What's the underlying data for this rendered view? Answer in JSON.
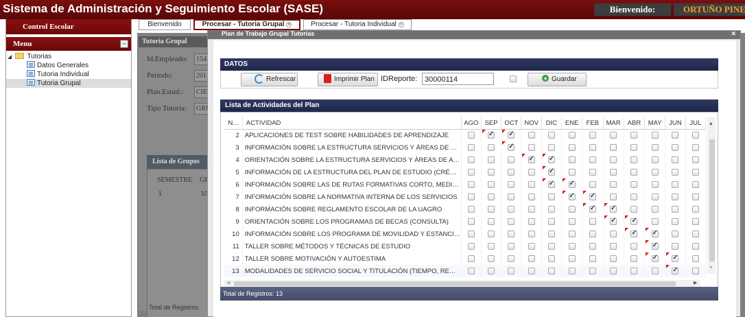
{
  "app": {
    "title": "Sistema de Administración y Seguimiento Escolar (SASE)",
    "welcome": "Bienvenido:",
    "user": "ORTUÑO PINE"
  },
  "sidebar": {
    "header": "Control Escolar",
    "menu_title": "Menu",
    "collapse_glyph": "–",
    "tree": {
      "root_label": "Tutorias",
      "items": [
        "Datos Generales",
        "Tutoria Individual",
        "Tutoria Grupal"
      ],
      "selected_index": 2
    }
  },
  "tabs": [
    {
      "label": "Bienvenido",
      "closable": false,
      "active": false
    },
    {
      "label": "Procesar - Tutoria Grupal",
      "closable": true,
      "active": true
    },
    {
      "label": "Procesar - Tutoria Individual",
      "closable": true,
      "active": false
    }
  ],
  "background_panel": {
    "title": "Tutoria Grupal",
    "fields": [
      {
        "label": "Id.Empleado:",
        "value": "154"
      },
      {
        "label": "Periodo:",
        "value": "201"
      },
      {
        "label": "Plan.Estud.:",
        "value": "CIE"
      },
      {
        "label": "Tipo Tutoria:",
        "value": "GRU"
      }
    ],
    "groups_title": "Lista de Grupos",
    "groups_columns": [
      "SEMESTRE",
      "GR"
    ],
    "groups_row": [
      "1",
      "10"
    ],
    "groups_total": "Total de Registros"
  },
  "modal": {
    "title": "Plan de Trabajo Grupal Tutorias",
    "datos_title": "DATOS",
    "refresh_label": "Refrescar",
    "print_label": "Imprimir Plan",
    "idreporte_label": "IDReporte:",
    "idreporte_value": "30000114",
    "save_label": "Guardar",
    "save_checkbox_checked": false,
    "list_title": "Lista de Actividades del Plan",
    "columns": [
      "N...",
      "ACTIVIDAD",
      "AGO",
      "SEP",
      "OCT",
      "NOV",
      "DIC",
      "ENE",
      "FEB",
      "MAR",
      "ABR",
      "MAY",
      "JUN",
      "JUL"
    ],
    "rows": [
      {
        "n": "2",
        "actividad": "APLICACIONES DE TEST SOBRE HABILIDADES DE APRENDIZAJE",
        "months": [
          0,
          1,
          1,
          0,
          0,
          0,
          0,
          0,
          0,
          0,
          0,
          0
        ],
        "dirty": [
          0,
          1,
          1,
          0,
          0,
          0,
          0,
          0,
          0,
          0,
          0,
          0
        ]
      },
      {
        "n": "3",
        "actividad": "INFORMACIÓN SOBRE LA ESTRUCTURA SERVICIOS Y ÁREAS DE APOYO",
        "months": [
          0,
          0,
          1,
          0,
          0,
          0,
          0,
          0,
          0,
          0,
          0,
          0
        ],
        "dirty": [
          0,
          0,
          1,
          0,
          0,
          0,
          0,
          0,
          0,
          0,
          0,
          0
        ]
      },
      {
        "n": "4",
        "actividad": "ORIENTACIÓN SOBRE LA ESTRUCTURA SERVICIOS Y ÁREAS DE APOYO",
        "months": [
          0,
          0,
          0,
          1,
          1,
          0,
          0,
          0,
          0,
          0,
          0,
          0
        ],
        "dirty": [
          0,
          0,
          0,
          1,
          1,
          0,
          0,
          0,
          0,
          0,
          0,
          0
        ]
      },
      {
        "n": "5",
        "actividad": "INFORMACIÓN DE LA ESTRUCTURA DEL PLAN DE ESTUDIO (CRÉDITOS)",
        "months": [
          0,
          0,
          0,
          0,
          1,
          0,
          0,
          0,
          0,
          0,
          0,
          0
        ],
        "dirty": [
          0,
          0,
          0,
          0,
          1,
          0,
          0,
          0,
          0,
          0,
          0,
          0
        ]
      },
      {
        "n": "6",
        "actividad": "INFORMACIÓN SOBRE LAS DE RUTAS FORMATIVAS CORTO, MEDIANO Y LARGO PLAZO",
        "months": [
          0,
          0,
          0,
          0,
          1,
          1,
          0,
          0,
          0,
          0,
          0,
          0
        ],
        "dirty": [
          0,
          0,
          0,
          0,
          1,
          1,
          0,
          0,
          0,
          0,
          0,
          0
        ]
      },
      {
        "n": "7",
        "actividad": "INFORMACIÓN SOBRE LA NORMATIVA INTERNA DE LOS SERVICIOS",
        "months": [
          0,
          0,
          0,
          0,
          0,
          1,
          1,
          0,
          0,
          0,
          0,
          0
        ],
        "dirty": [
          0,
          0,
          0,
          0,
          0,
          1,
          1,
          0,
          0,
          0,
          0,
          0
        ]
      },
      {
        "n": "8",
        "actividad": "INFORMACIÓN SOBRE REGLAMENTO ESCOLAR DE LA UAGRO",
        "months": [
          0,
          0,
          0,
          0,
          0,
          0,
          1,
          1,
          0,
          0,
          0,
          0
        ],
        "dirty": [
          0,
          0,
          0,
          0,
          0,
          0,
          1,
          1,
          0,
          0,
          0,
          0
        ]
      },
      {
        "n": "9",
        "actividad": "ORIENTACIÓN SOBRE LOS PROGRAMAS DE BECAS (CONSULTA)",
        "months": [
          0,
          0,
          0,
          0,
          0,
          0,
          0,
          1,
          1,
          0,
          0,
          0
        ],
        "dirty": [
          0,
          0,
          0,
          0,
          0,
          0,
          0,
          1,
          1,
          0,
          0,
          0
        ]
      },
      {
        "n": "10",
        "actividad": "INFORMACIÓN SOBRE LOS PROGRAMA DE MOVILIDAD Y ESTANCIAS",
        "months": [
          0,
          0,
          0,
          0,
          0,
          0,
          0,
          0,
          1,
          1,
          0,
          0
        ],
        "dirty": [
          0,
          0,
          0,
          0,
          0,
          0,
          0,
          0,
          1,
          1,
          0,
          0
        ]
      },
      {
        "n": "11",
        "actividad": "TALLER SOBRE MÉTODOS Y TÉCNICAS DE ESTUDIO",
        "months": [
          0,
          0,
          0,
          0,
          0,
          0,
          0,
          0,
          0,
          1,
          0,
          0
        ],
        "dirty": [
          0,
          0,
          0,
          0,
          0,
          0,
          0,
          0,
          0,
          1,
          0,
          0
        ]
      },
      {
        "n": "12",
        "actividad": "TALLER SOBRE MOTIVACIÓN Y AUTOESTIMA",
        "months": [
          0,
          0,
          0,
          0,
          0,
          0,
          0,
          0,
          0,
          1,
          1,
          0
        ],
        "dirty": [
          0,
          0,
          0,
          0,
          0,
          0,
          0,
          0,
          0,
          1,
          1,
          0
        ]
      },
      {
        "n": "13",
        "actividad": "MODALIDADES DE SERVICIO SOCIAL Y TITULACIÓN (TIEMPO, REQUISITOS)",
        "months": [
          0,
          0,
          0,
          0,
          0,
          0,
          0,
          0,
          0,
          0,
          1,
          0
        ],
        "dirty": [
          0,
          0,
          0,
          0,
          0,
          0,
          0,
          0,
          0,
          0,
          1,
          0
        ]
      }
    ],
    "total_label": "Total de Registros: 13"
  }
}
